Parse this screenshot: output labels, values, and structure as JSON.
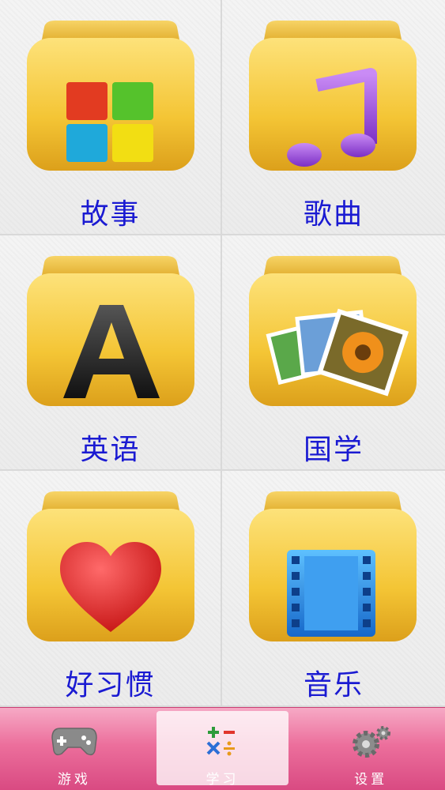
{
  "menu": {
    "items": [
      {
        "label": "故事",
        "icon": "blocks-icon"
      },
      {
        "label": "歌曲",
        "icon": "music-note-icon"
      },
      {
        "label": "英语",
        "icon": "letter-a-icon"
      },
      {
        "label": "国学",
        "icon": "photos-icon"
      },
      {
        "label": "好习惯",
        "icon": "heart-icon"
      },
      {
        "label": "音乐",
        "icon": "film-icon"
      }
    ]
  },
  "tabbar": {
    "tabs": [
      {
        "label": "游戏",
        "icon": "gamepad-icon",
        "active": false
      },
      {
        "label": "学习",
        "icon": "math-symbols-icon",
        "active": true
      },
      {
        "label": "设置",
        "icon": "gears-icon",
        "active": false
      }
    ]
  },
  "colors": {
    "label": "#1a1ad2",
    "folder": "#f2c232",
    "tabbar": "#e8679a"
  }
}
